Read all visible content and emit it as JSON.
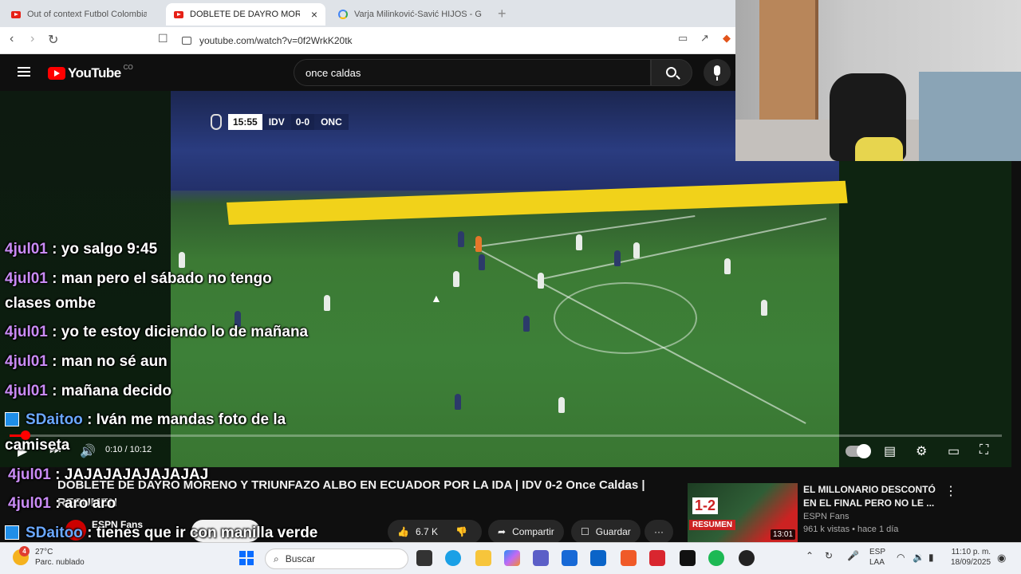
{
  "browser": {
    "tabs": [
      {
        "label": "Out of context Futbol Colombiano",
        "active": false
      },
      {
        "label": "DOBLETE DE DAYRO MORENO",
        "active": true
      },
      {
        "label": "Varja Milinković-Savić HIJOS - Googl",
        "active": false
      }
    ],
    "new_tab_label": "+",
    "close_label": "×",
    "url": "youtube.com/watch?v=0f2WrkK20tk"
  },
  "youtube": {
    "logo_text": "YouTube",
    "country_code": "CO",
    "search_value": "once caldas"
  },
  "scorebug": {
    "clock": "15:55",
    "home": "IDV",
    "score": "0-0",
    "away": "ONC"
  },
  "chat": [
    {
      "user": "4jul01",
      "text": ": yo salgo 9:45"
    },
    {
      "user": "4jul01",
      "text": ": man pero el sábado no tengo"
    },
    {
      "user": "",
      "text": "clases ombe"
    },
    {
      "user": "4jul01",
      "text": ": yo te estoy diciendo lo de mañana"
    },
    {
      "user": "4jul01",
      "text": ": man no sé aun"
    },
    {
      "user": "4jul01",
      "text": ": mañana decido"
    },
    {
      "user": "SDaitoo",
      "text": ": Iván me mandas foto de la"
    },
    {
      "user": "",
      "text": "camiseta"
    },
    {
      "user": "4jul01",
      "text": ": JAJAJAJAJAJAJAJ"
    },
    {
      "user": "4jul01",
      "text": ": aro aro"
    },
    {
      "user": "SDaitoo",
      "text": ": tienes que ir con manilla verde"
    }
  ],
  "controls": {
    "time": "0:10 / 10:12",
    "progress": 0.016
  },
  "video": {
    "title": "DOBLETE DE DAYRO MORENO Y TRIUNFAZO ALBO EN ECUADOR POR LA IDA | IDV 0-2 Once Caldas | RESUMEN",
    "channel": "ESPN Fans",
    "likes": "6.7 K",
    "share_label": "Compartir",
    "save_label": "Guardar",
    "more_label": "···"
  },
  "recommended": {
    "title": "EL MILLONARIO DESCONTÓ EN EL FINAL PERO NO LE ...",
    "channel": "ESPN Fans",
    "meta": "961 k vistas • hace 1 día",
    "duration": "13:01",
    "thumb_score": "1-2",
    "thumb_label": "RESUMEN"
  },
  "taskbar": {
    "weather_temp": "27°C",
    "weather_desc": "Parc. nublado",
    "notification_count": "4",
    "search_placeholder": "Buscar",
    "lang_top": "ESP",
    "lang_bottom": "LAA",
    "time": "11:10 p. m.",
    "date": "18/09/2025"
  },
  "colors": {
    "youtube_red": "#ff0000",
    "chat_user_purple": "#c98bf5",
    "chat_user_blue": "#6aa8ff"
  }
}
